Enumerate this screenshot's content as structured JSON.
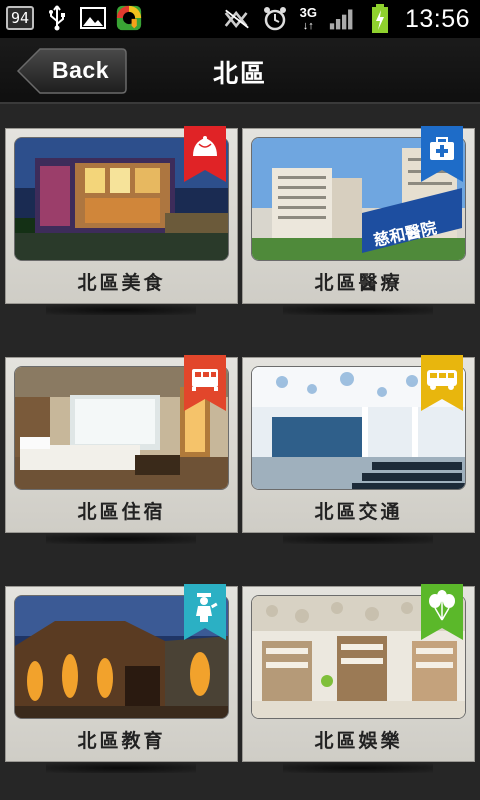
{
  "status_bar": {
    "battery_level": "94",
    "network": "3G",
    "time": "13:56",
    "icons": [
      "usb-icon",
      "gallery-icon",
      "app-shield-icon",
      "mute-icon",
      "alarm-icon",
      "signal-icon",
      "battery-charging-icon"
    ]
  },
  "header": {
    "back_label": "Back",
    "title": "北區"
  },
  "categories": [
    {
      "label": "北區美食",
      "icon": "dumpling-icon",
      "badge_color": "#e02326"
    },
    {
      "label": "北區醫療",
      "icon": "medical-kit-icon",
      "badge_color": "#1e6cc8"
    },
    {
      "label": "北區住宿",
      "icon": "bed-icon",
      "badge_color": "#e2462b"
    },
    {
      "label": "北區交通",
      "icon": "bus-icon",
      "badge_color": "#e8b60d"
    },
    {
      "label": "北區教育",
      "icon": "graduate-icon",
      "badge_color": "#2bb0c4"
    },
    {
      "label": "北區娛樂",
      "icon": "balloons-icon",
      "badge_color": "#5bb82a"
    }
  ],
  "photo_texts": {
    "hospital_sign": "慈和醫院"
  }
}
